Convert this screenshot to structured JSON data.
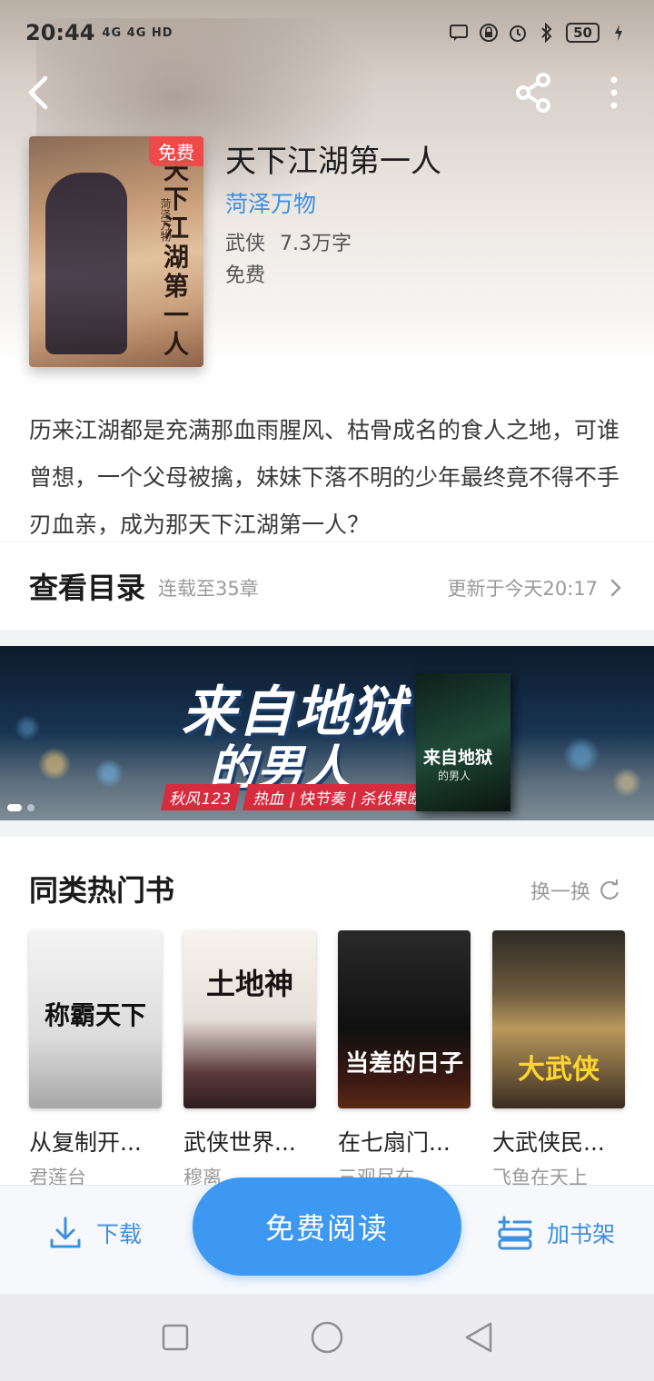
{
  "status_bar": {
    "time": "20:44",
    "network": "4G 4G HD",
    "battery": "50"
  },
  "book": {
    "title": "天下江湖第一人",
    "author": "菏泽万物",
    "genre": "武侠",
    "word_count": "7.3万字",
    "price": "免费",
    "badge": "免费",
    "cover_title": "天下江湖第一人",
    "cover_author": "菏泽万物",
    "description": "历来江湖都是充满那血雨腥风、枯骨成名的食人之地，可谁曾想，一个父母被擒，妹妹下落不明的少年最终竟不得不手刃血亲，成为那天下江湖第一人？"
  },
  "catalog": {
    "title": "查看目录",
    "serial": "连载至35章",
    "updated": "更新于今天20:17"
  },
  "banner": {
    "title_line1": "来自地狱",
    "title_line2": "的男人",
    "author": "秋风123",
    "tags": "热血 | 快节奏 | 杀伐果断",
    "book_title": "来自地狱",
    "book_subtitle": "的男人",
    "slides": 2,
    "active_slide": 1
  },
  "similar": {
    "title": "同类热门书",
    "refresh_label": "换一换",
    "books": [
      {
        "name": "从复制开...",
        "author": "君莲台",
        "cover_text": "称霸天下"
      },
      {
        "name": "武侠世界...",
        "author": "穆离",
        "cover_text": "土地神"
      },
      {
        "name": "在七扇门...",
        "author": "三观尽在",
        "cover_text": "当差的日子"
      },
      {
        "name": "大武侠民...",
        "author": "飞鱼在天上",
        "cover_text": "大武侠"
      }
    ]
  },
  "actions": {
    "download": "下载",
    "read": "免费阅读",
    "add_shelf": "加书架"
  },
  "colors": {
    "accent": "#3c98f0",
    "link": "#3d8fe0",
    "badge": "#ef4a4a"
  }
}
